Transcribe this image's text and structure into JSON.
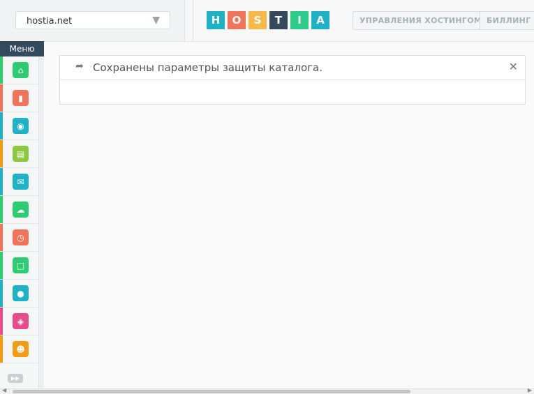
{
  "header": {
    "domain_value": "hostia.net",
    "logo_letters": [
      "H",
      "O",
      "S",
      "T",
      "I",
      "A"
    ],
    "logo_colors": [
      "#1fb2c6",
      "#f0735a",
      "#f7b94a",
      "#34495e",
      "#2ecc8a",
      "#1fb2c6"
    ],
    "nav": [
      "УПРАВЛЕНИЯ ХОСТИНГОМ",
      "БИЛЛИНГ П"
    ]
  },
  "sidebar": {
    "menu_label": "Меню",
    "items": [
      {
        "icon": "home-icon",
        "bar": "#2ecc71",
        "bg": "#2ecc71"
      },
      {
        "icon": "folder-icon",
        "bar": "#f0735a",
        "bg": "#f0735a"
      },
      {
        "icon": "www-globe-icon",
        "bar": "#1fb2c6",
        "bg": "#1fb2c6"
      },
      {
        "icon": "database-icon",
        "bar": "#f39c12",
        "bg": "#8dc63f"
      },
      {
        "icon": "mail-icon",
        "bar": "#1fb2c6",
        "bg": "#1fb2c6"
      },
      {
        "icon": "ftp-icon",
        "bar": "#2ecc71",
        "bg": "#2ecc71"
      },
      {
        "icon": "clock-icon",
        "bar": "#f0735a",
        "bg": "#f0735a"
      },
      {
        "icon": "calendar-icon",
        "bar": "#2ecc71",
        "bg": "#2ecc71"
      },
      {
        "icon": "php-icon",
        "bar": "#1fb2c6",
        "bg": "#1fb2c6"
      },
      {
        "icon": "shield-icon",
        "bar": "#e84c8a",
        "bg": "#e84c8a"
      },
      {
        "icon": "user-gear-icon",
        "bar": "#f39c12",
        "bg": "#f39c12"
      }
    ]
  },
  "notice": {
    "message": "Сохранены параметры защиты каталога."
  }
}
